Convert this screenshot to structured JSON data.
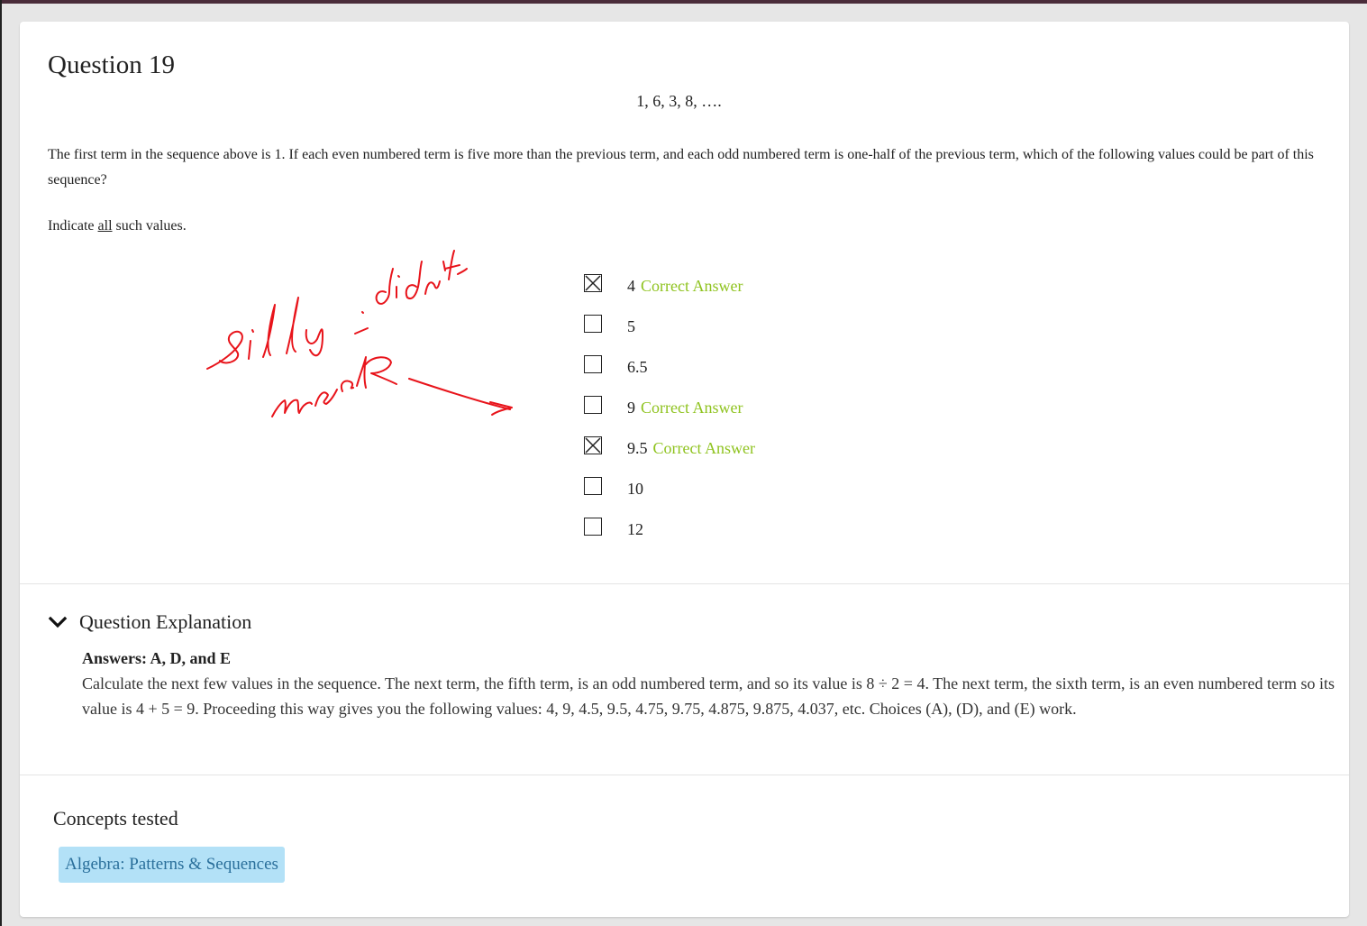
{
  "question": {
    "title": "Question 19",
    "sequence": "1, 6, 3, 8, ….",
    "prompt": "The first term in the sequence above is 1. If each even numbered term is five more than the previous term, and each odd numbered term is one-half of the previous term, which of the following values could be part of this sequence?",
    "indicate_pre": "Indicate ",
    "indicate_all": "all",
    "indicate_post": " such values."
  },
  "choices": [
    {
      "value": "4",
      "correct_label": "Correct Answer",
      "checked": true
    },
    {
      "value": "5",
      "correct_label": "",
      "checked": false
    },
    {
      "value": "6.5",
      "correct_label": "",
      "checked": false
    },
    {
      "value": "9",
      "correct_label": "Correct Answer",
      "checked": false
    },
    {
      "value": "9.5",
      "correct_label": "Correct Answer",
      "checked": true
    },
    {
      "value": "10",
      "correct_label": "",
      "checked": false
    },
    {
      "value": "12",
      "correct_label": "",
      "checked": false
    }
  ],
  "explanation": {
    "heading": "Question Explanation",
    "answers": "Answers: A, D, and E",
    "body": "Calculate the next few values in the sequence. The next term, the fifth term, is an odd numbered term, and so its value is 8 ÷ 2 = 4. The next term, the sixth term, is an even numbered term so its value is 4 + 5 = 9. Proceeding this way gives you the following values: 4, 9, 4.5, 9.5, 4.75, 9.75, 4.875, 9.875, 4.037, etc. Choices (A), (D), and (E) work."
  },
  "concepts": {
    "title": "Concepts tested",
    "tags": [
      "Algebra: Patterns & Sequences"
    ]
  },
  "annotation": {
    "color": "#e8141b",
    "handwritten_text": "silly - didn't mark"
  },
  "colors": {
    "correct": "#8fc31f",
    "tag_bg": "#b3e1f7",
    "tag_text": "#2a6f9b"
  },
  "icons": {
    "checked_box": "x-checkbox-icon",
    "unchecked_box": "empty-checkbox-icon",
    "expand": "chevron-down-icon"
  }
}
